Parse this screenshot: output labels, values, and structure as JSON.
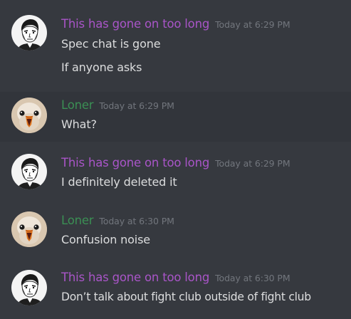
{
  "colors": {
    "background": "#36393f",
    "hover_background": "#32353b",
    "author_purple": "#a955c8",
    "author_green": "#3b8f54",
    "text": "#dcddde",
    "timestamp": "#72767d"
  },
  "messages": [
    {
      "author": "This has gone on too long",
      "timestamp": "Today at 6:29 PM",
      "avatar": "man-sketch-avatar",
      "lines": [
        "Spec chat is gone",
        "If anyone asks"
      ]
    },
    {
      "author": "Loner",
      "timestamp": "Today at 6:29 PM",
      "avatar": "bird-avatar",
      "lines": [
        "What?"
      ]
    },
    {
      "author": "This has gone on too long",
      "timestamp": "Today at 6:29 PM",
      "avatar": "man-sketch-avatar",
      "lines": [
        "I definitely deleted it"
      ]
    },
    {
      "author": "Loner",
      "timestamp": "Today at 6:30 PM",
      "avatar": "bird-avatar",
      "lines": [
        "Confusion noise"
      ]
    },
    {
      "author": "This has gone on too long",
      "timestamp": "Today at 6:30 PM",
      "avatar": "man-sketch-avatar",
      "lines": [
        "Don’t talk about fight club outside of fight club"
      ]
    }
  ]
}
